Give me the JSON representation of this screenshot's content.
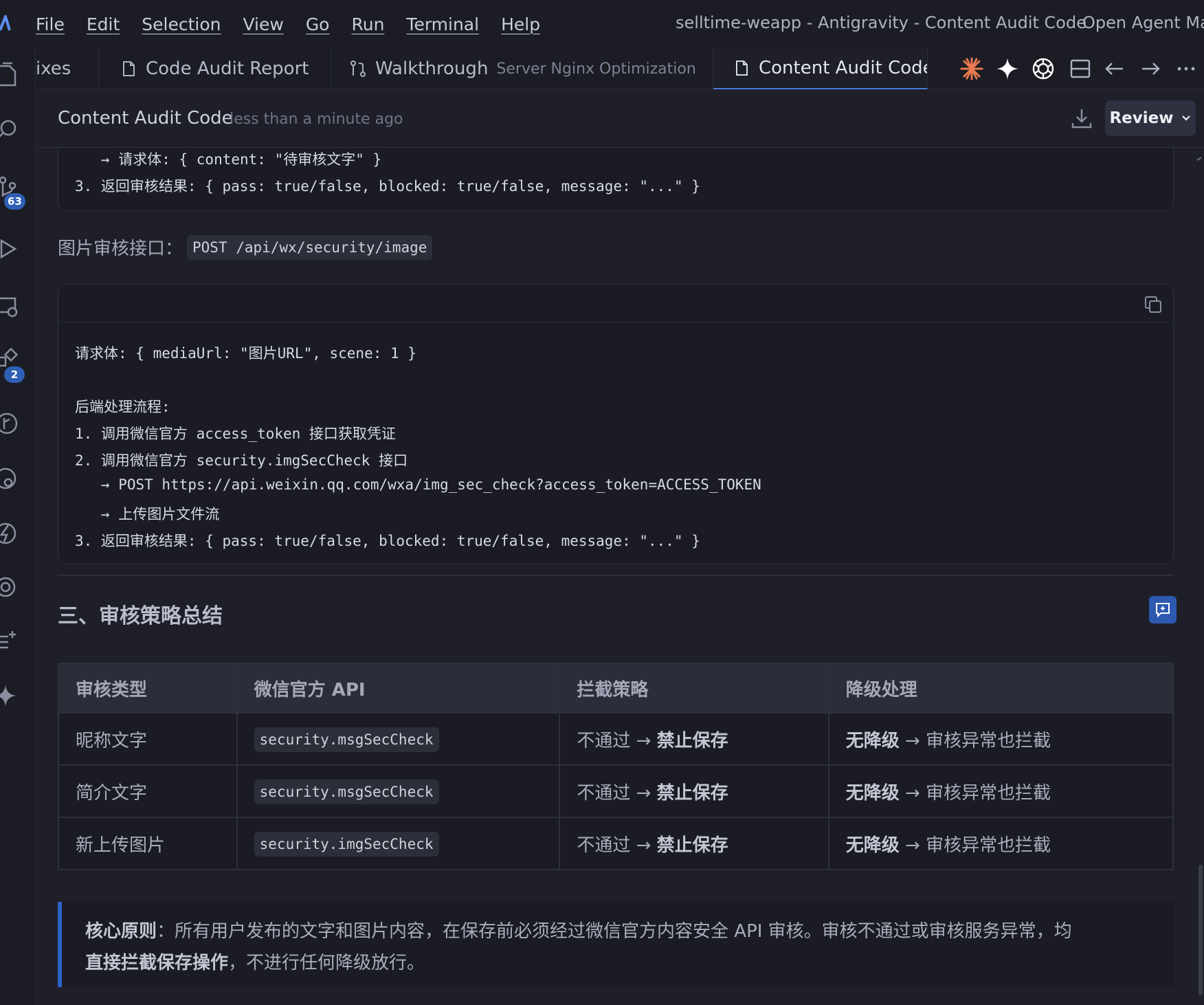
{
  "menubar": {
    "items": [
      "File",
      "Edit",
      "Selection",
      "View",
      "Go",
      "Run",
      "Terminal",
      "Help"
    ],
    "window_title": "selltime-weapp - Antigravity - Content Audit Code",
    "open_agent": "Open Agent Mar"
  },
  "activity": {
    "source_control_badge": "63",
    "extensions_badge": "2"
  },
  "tabs": [
    {
      "label": "ixes",
      "description": ""
    },
    {
      "label": "Code Audit Report",
      "description": ""
    },
    {
      "label": "Walkthrough",
      "description": "Server Nginx Optimization"
    },
    {
      "label": "Content Audit Code",
      "description": "",
      "active": true
    }
  ],
  "doc": {
    "title": "Content Audit Code",
    "time": "less than a minute ago",
    "review_label": "Review"
  },
  "content": {
    "top_code_lines": [
      "   → 请求体: { content: \"待审核文字\" }",
      "3. 返回审核结果: { pass: true/false, blocked: true/false, message: \"...\" }"
    ],
    "image_section_label": "图片审核接口：",
    "image_section_endpoint": "POST /api/wx/security/image",
    "image_code_lines": [
      "请求体: { mediaUrl: \"图片URL\", scene: 1 }",
      "",
      "后端处理流程:",
      "1. 调用微信官方 access_token 接口获取凭证",
      "2. 调用微信官方 security.imgSecCheck 接口",
      "   → POST https://api.weixin.qq.com/wxa/img_sec_check?access_token=ACCESS_TOKEN",
      "   → 上传图片文件流",
      "3. 返回审核结果: { pass: true/false, blocked: true/false, message: \"...\" }"
    ],
    "summary_heading": "三、审核策略总结",
    "table": {
      "headers": [
        "审核类型",
        "微信官方 API",
        "拦截策略",
        "降级处理"
      ],
      "rows": [
        {
          "type": "昵称文字",
          "api": "security.msgSecCheck",
          "policy_prefix": "不通过 → ",
          "policy_bold": "禁止保存",
          "fallback_bold": "无降级",
          "fallback_rest": " → 审核异常也拦截"
        },
        {
          "type": "简介文字",
          "api": "security.msgSecCheck",
          "policy_prefix": "不通过 → ",
          "policy_bold": "禁止保存",
          "fallback_bold": "无降级",
          "fallback_rest": " → 审核异常也拦截"
        },
        {
          "type": "新上传图片",
          "api": "security.imgSecCheck",
          "policy_prefix": "不通过 → ",
          "policy_bold": "禁止保存",
          "fallback_bold": "无降级",
          "fallback_rest": " → 审核异常也拦截"
        }
      ]
    },
    "callout": {
      "label": "核心原则",
      "text1": "：所有用户发布的文字和图片内容，在保存前必须经过微信官方内容安全 API 审核。审核不通过或审核服务异常，均",
      "bold2": "直接拦截保存操作",
      "text2": "，不进行任何降级放行。"
    }
  },
  "colors": {
    "accent": "#2d63c8",
    "tab_active_underline": "#4b7bd9",
    "claude_icon": "#e87a4f",
    "background": "#1e1f29"
  }
}
